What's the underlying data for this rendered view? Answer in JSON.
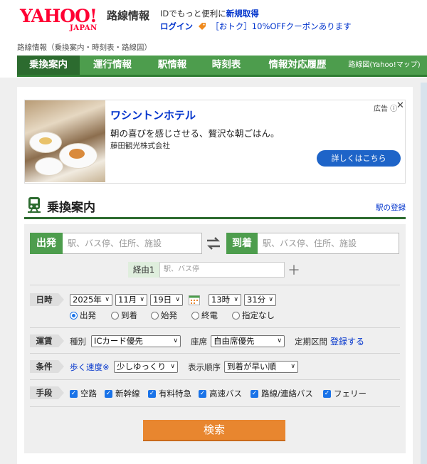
{
  "header": {
    "logo_text": "YAHOO!",
    "logo_sub": "JAPAN",
    "service_name": "路線情報",
    "promo_line1_prefix": "IDでもっと便利に",
    "promo_line1_link": "新規取得",
    "promo_login": "ログイン",
    "promo_coupon": "［おトク］10%OFFクーポンあります"
  },
  "breadcrumb": "路線情報（乗換案内・時刻表・路線図）",
  "nav": {
    "items": [
      {
        "label": "乗換案内",
        "active": true
      },
      {
        "label": "運行情報"
      },
      {
        "label": "駅情報"
      },
      {
        "label": "時刻表"
      },
      {
        "label": "情報対応履歴"
      },
      {
        "label": "路線図(Yahoo!マップ)"
      }
    ]
  },
  "ad": {
    "label": "広告",
    "title": "ワシントンホテル",
    "text": "朝の喜びを感じさせる、贅沢な朝ごはん。",
    "company": "藤田観光株式会社",
    "button": "詳しくはこちら"
  },
  "section": {
    "title": "乗換案内",
    "station_link": "駅の登録"
  },
  "route": {
    "from_label": "出発",
    "from_placeholder": "駅、バス停、住所、施設",
    "to_label": "到着",
    "to_placeholder": "駅、バス停、住所、施設",
    "via_label": "経由1",
    "via_placeholder": "駅、バス停"
  },
  "datetime": {
    "label": "日時",
    "year": "2025年",
    "month": "11月",
    "day": "19日",
    "hour": "13時",
    "minute": "31分",
    "options": [
      "出発",
      "到着",
      "始発",
      "終電",
      "指定なし"
    ],
    "selected": "出発"
  },
  "fare": {
    "label": "運賃",
    "type_label": "種別",
    "type_value": "ICカード優先",
    "seat_label": "座席",
    "seat_value": "自由席優先",
    "commuter_label": "定期区間",
    "commuter_link": "登録する"
  },
  "conditions": {
    "label": "条件",
    "walk_label": "歩く速度※",
    "walk_value": "少しゆっくり",
    "order_label": "表示順序",
    "order_value": "到着が早い順"
  },
  "means": {
    "label": "手段",
    "items": [
      "空路",
      "新幹線",
      "有料特急",
      "高速バス",
      "路線/連絡バス",
      "フェリー"
    ]
  },
  "search_button": "検索",
  "colors": {
    "nav_green": "#4d9d4d",
    "nav_active": "#2c6b2f",
    "link_blue": "#0033cc",
    "search_orange": "#e8862f",
    "yahoo_red": "#ff0033"
  }
}
